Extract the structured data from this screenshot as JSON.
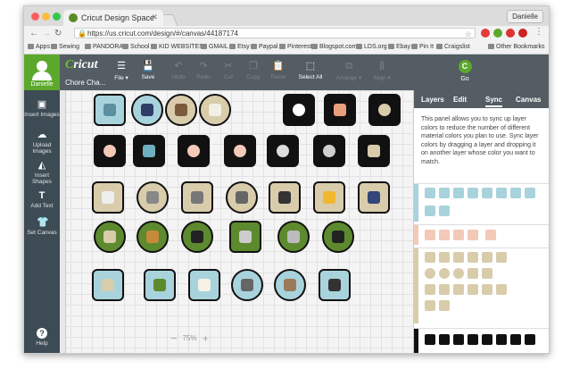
{
  "browser": {
    "tab_title": "Cricut Design Space",
    "url": "https://us.cricut.com/design/#/canvas/44187174",
    "profile": "Danielle",
    "bookmarks": [
      "Apps",
      "Sewing",
      "PANDORA",
      "School",
      "KID WEBSITES",
      "GMAIL",
      "Etsy",
      "Paypal",
      "Pinterest",
      "Blogspot.com",
      "LDS.org",
      "Ebay",
      "Pin It",
      "Craigslist",
      "Other Bookmarks"
    ]
  },
  "app": {
    "logo_prefix": "C",
    "logo_rest": "ricut",
    "project_title": "Chore Cha...",
    "user_name": "Danielle",
    "sidebar": [
      {
        "label": "Insert Images",
        "icon": "image-icon"
      },
      {
        "label": "Upload Images",
        "icon": "upload-cloud-icon"
      },
      {
        "label": "Insert Shapes",
        "icon": "shapes-icon"
      },
      {
        "label": "Add Text",
        "icon": "text-icon"
      },
      {
        "label": "Set Canvas",
        "icon": "tshirt-icon"
      },
      {
        "label": "Help",
        "icon": "help-icon"
      }
    ],
    "toolbar": [
      {
        "label": "File",
        "enabled": true
      },
      {
        "label": "Save",
        "enabled": true
      },
      {
        "label": "Undo",
        "enabled": false
      },
      {
        "label": "Redo",
        "enabled": false
      },
      {
        "label": "Cut",
        "enabled": false
      },
      {
        "label": "Copy",
        "enabled": false
      },
      {
        "label": "Paste",
        "enabled": false
      },
      {
        "label": "Select All",
        "enabled": true
      },
      {
        "label": "Arrange",
        "enabled": false
      },
      {
        "label": "Align",
        "enabled": false
      }
    ],
    "go_label": "Go",
    "zoom": "75%",
    "panel_tabs": [
      "Layers",
      "Edit",
      "Sync",
      "Canvas"
    ],
    "panel_active_tab": "Sync",
    "panel_description": "This panel allows you to sync up layer colors to reduce the number of different material colors you plan to use. Sync layer colors by dragging a layer and dropping it on another layer whose color you want to match.",
    "colors": {
      "accent_green": "#5ca82c",
      "sidebar": "#3d4b54",
      "toolbar": "#535d63",
      "tan": "#d8ccab",
      "light_blue": "#a8d3dc",
      "olive_green": "#5d8a2e",
      "salmon": "#f3c9b8",
      "black": "#111111"
    }
  }
}
